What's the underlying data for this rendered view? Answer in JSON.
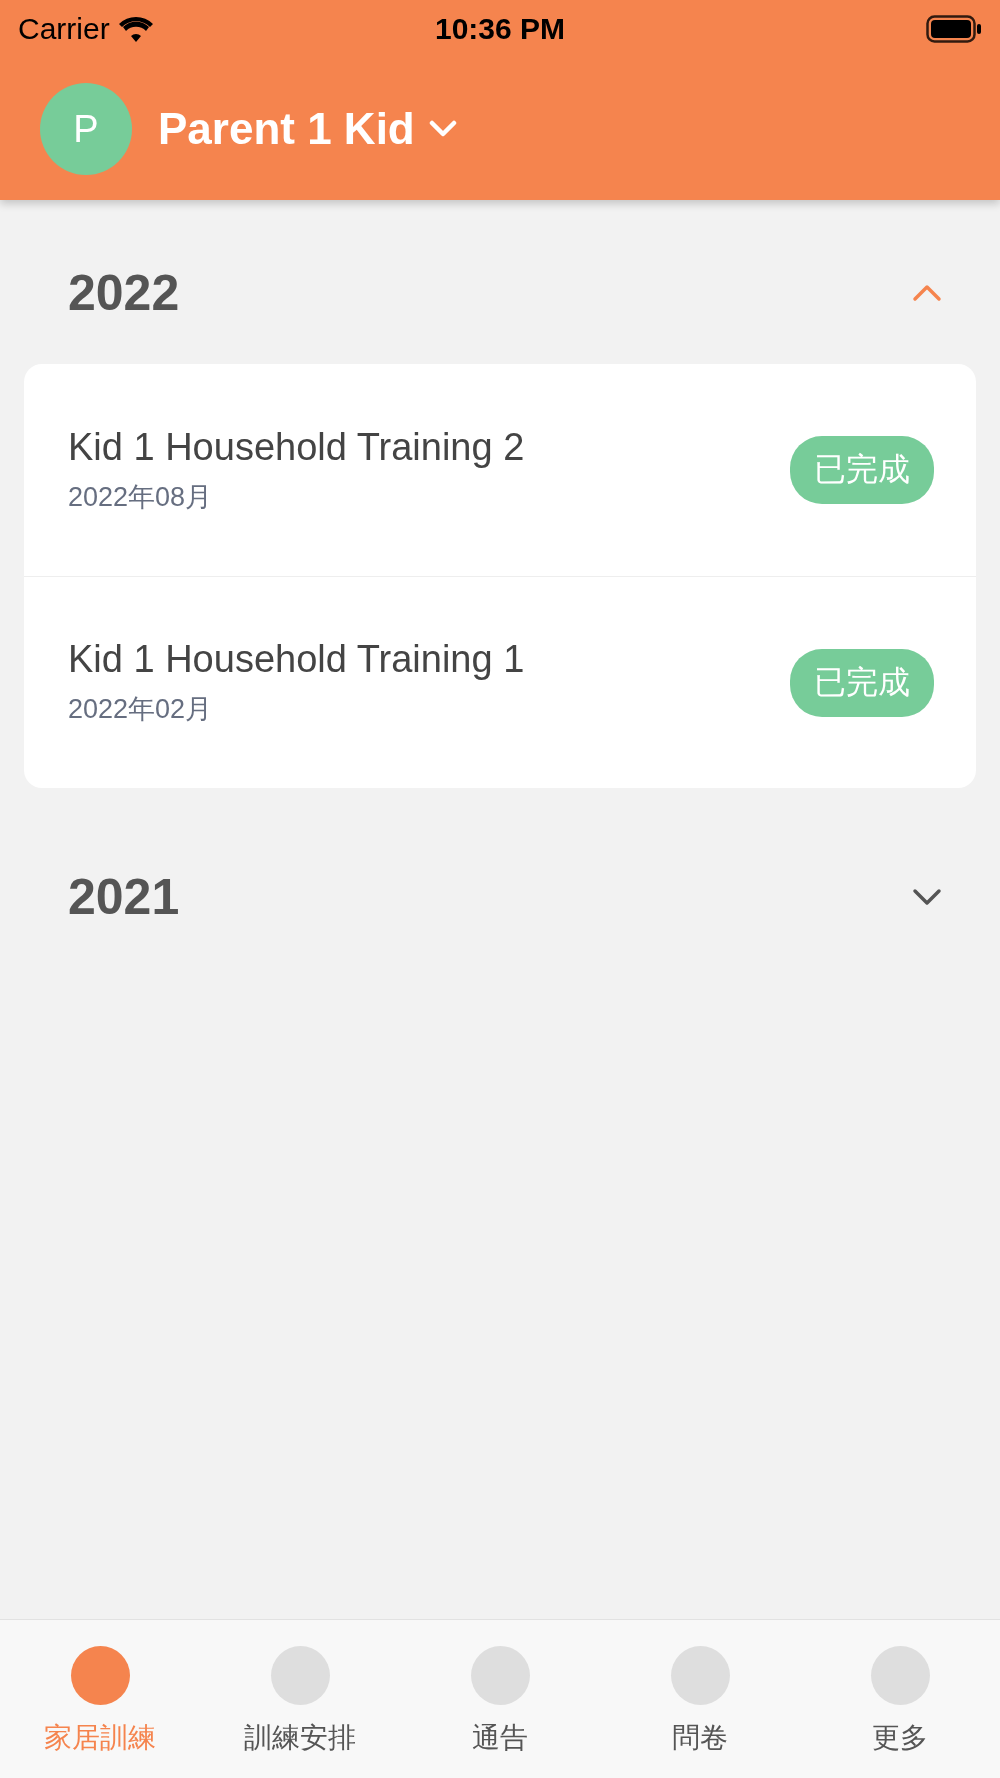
{
  "status_bar": {
    "carrier": "Carrier",
    "time": "10:36 PM"
  },
  "header": {
    "avatar": "P",
    "title": "Parent 1 Kid"
  },
  "sections": [
    {
      "year": "2022",
      "expanded": true,
      "items": [
        {
          "title": "Kid 1 Household Training 2",
          "date": "2022年08月",
          "status": "已完成"
        },
        {
          "title": "Kid 1 Household Training 1",
          "date": "2022年02月",
          "status": "已完成"
        }
      ]
    },
    {
      "year": "2021",
      "expanded": false
    }
  ],
  "tabs": [
    {
      "label": "家居訓練",
      "selected": true
    },
    {
      "label": "訓練安排",
      "selected": false
    },
    {
      "label": "通告",
      "selected": false
    },
    {
      "label": "問卷",
      "selected": false
    },
    {
      "label": "更多",
      "selected": false
    }
  ]
}
